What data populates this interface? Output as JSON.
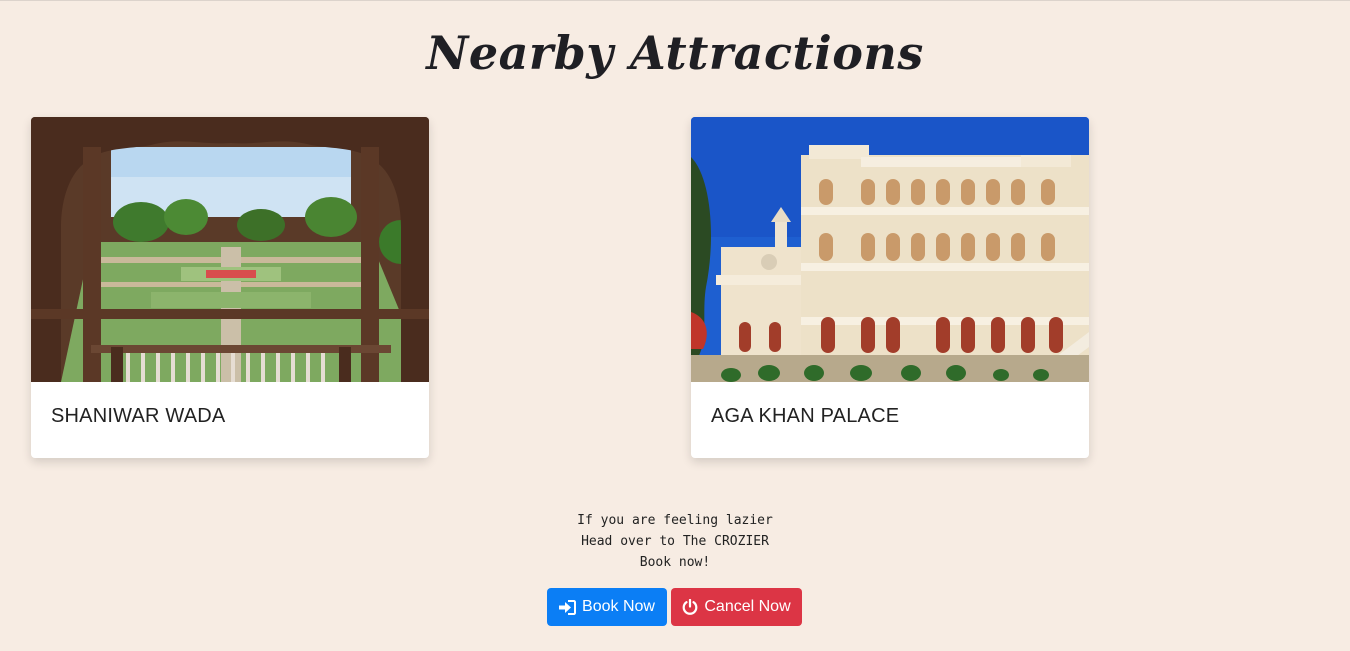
{
  "page": {
    "title": "Nearby Attractions"
  },
  "attractions": [
    {
      "name": "SHANIWAR WADA",
      "image": "garden-through-arch-photo"
    },
    {
      "name": "AGA KHAN PALACE",
      "image": "palace-photo"
    }
  ],
  "promo": {
    "line1": "If you are feeling lazier",
    "line2": "Head over to The CROZIER",
    "line3": "Book now!"
  },
  "actions": {
    "book_label": "Book Now",
    "book_icon": "sign-in-icon",
    "book_color": "#0b7ef5",
    "cancel_label": "Cancel Now",
    "cancel_icon": "power-icon",
    "cancel_color": "#dc3545"
  },
  "colors": {
    "background": "#f7ece3"
  }
}
